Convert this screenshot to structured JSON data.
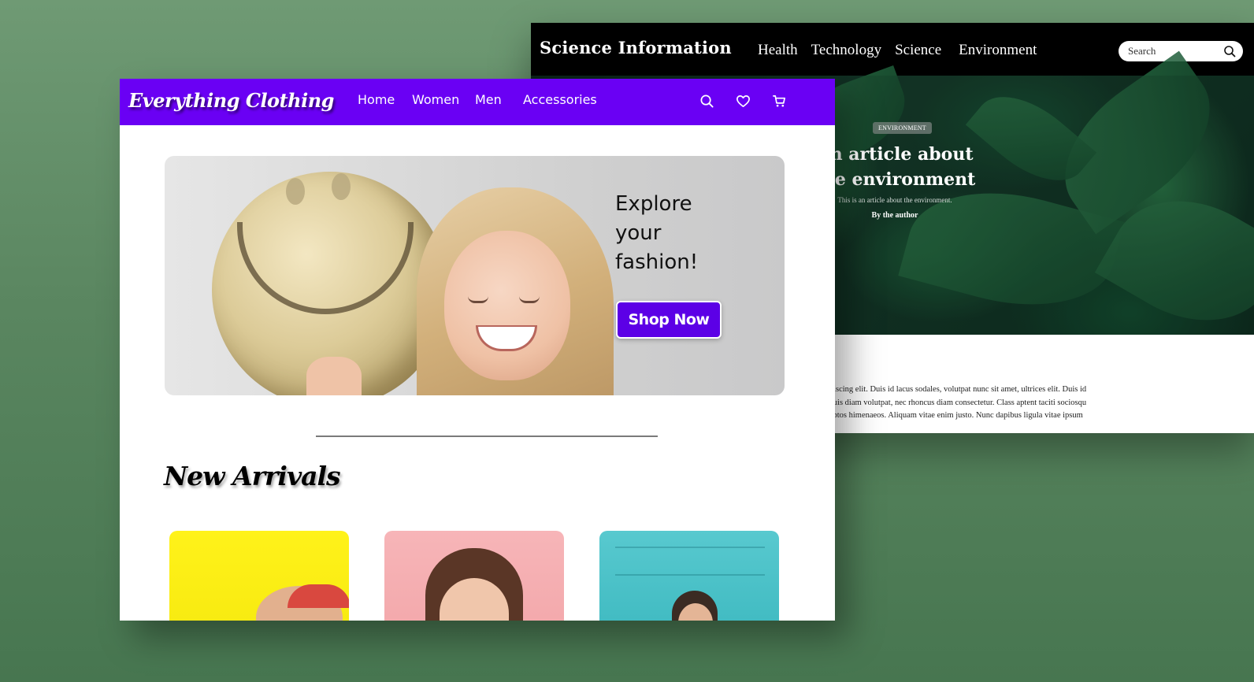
{
  "science_site": {
    "logo": "Science Information",
    "nav": [
      "Health",
      "Technology",
      "Science",
      "Environment"
    ],
    "search": {
      "placeholder": "Search"
    },
    "hero": {
      "badge": "ENVIRONMENT",
      "title": "An article about the environment",
      "subtitle": "This is an article about the environment.",
      "author": "By the author"
    },
    "body_lines": [
      "adipiscing elit. Duis id lacus sodales, volutpat nunc sit amet, ultrices elit. Duis id",
      "ex quis diam volutpat, nec rhoncus diam consectetur. Class aptent taciti sociosqu",
      "inceptos himenaeos. Aliquam vitae enim justo. Nunc dapibus ligula vitae ipsum"
    ]
  },
  "clothing_site": {
    "logo": "Everything Clothing",
    "nav": {
      "home": "Home",
      "women": "Women",
      "men": "Men",
      "accessories": "Accessories"
    },
    "icons": [
      "search-icon",
      "heart-icon",
      "cart-icon"
    ],
    "hero": {
      "headline_lines": [
        "Explore",
        "your",
        "fashion!"
      ],
      "button": "Shop Now"
    },
    "section_title": "New Arrivals",
    "colors": {
      "nav": "#6a00f4",
      "button": "#5c00e6",
      "card_yellow": "#fff21a",
      "card_pink": "#f7b5b8",
      "card_teal": "#58c9cf"
    }
  }
}
